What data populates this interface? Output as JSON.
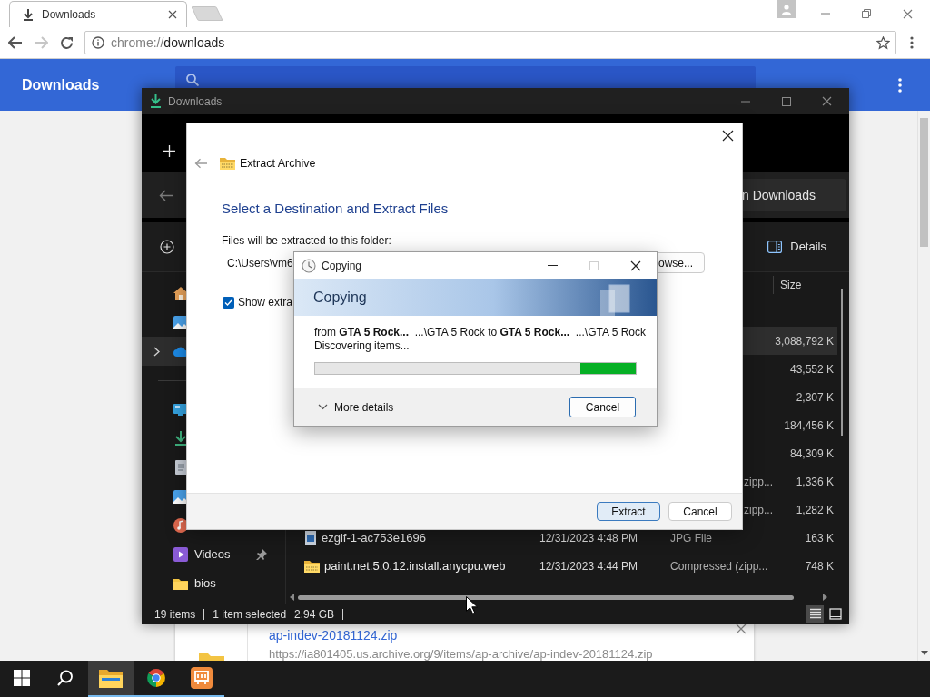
{
  "browser": {
    "tab_title": "Downloads",
    "address_scheme": "chrome://",
    "address_path": "downloads",
    "page_title": "Downloads",
    "download": {
      "filename": "ap-indev-20181124.zip",
      "url": "https://ia801405.us.archive.org/9/items/ap-archive/ap-indev-20181124.zip"
    }
  },
  "explorer": {
    "title": "Downloads",
    "search_text": "n Downloads",
    "details_label": "Details",
    "size_header": "Size",
    "sidebar": [
      {
        "kind": "home",
        "selected": false,
        "expandable": false,
        "pinned": false
      },
      {
        "kind": "gallery",
        "selected": false,
        "expandable": false,
        "pinned": false
      },
      {
        "kind": "onedrive",
        "selected": true,
        "expandable": true,
        "pinned": false
      },
      {
        "kind": "desktop",
        "selected": false,
        "expandable": false,
        "pinned": false
      },
      {
        "kind": "downloads",
        "selected": false,
        "expandable": false,
        "pinned": false
      },
      {
        "kind": "documents",
        "selected": false,
        "expandable": false,
        "pinned": false
      },
      {
        "kind": "pictures",
        "selected": false,
        "expandable": false,
        "pinned": false
      },
      {
        "kind": "music",
        "selected": false,
        "expandable": false,
        "pinned": false
      },
      {
        "kind": "videos",
        "label": "Videos",
        "selected": false,
        "expandable": false,
        "pinned": true
      },
      {
        "kind": "folder",
        "label": "bios",
        "selected": false,
        "expandable": false,
        "pinned": false
      }
    ],
    "rows": [
      {
        "kind": "covered",
        "size": "3,088,792 K",
        "selected": true
      },
      {
        "kind": "covered",
        "size": "43,552 K",
        "selected": false
      },
      {
        "kind": "covered",
        "size": "2,307 K",
        "selected": false
      },
      {
        "kind": "covered",
        "size": "184,456 K",
        "selected": false
      },
      {
        "kind": "covered",
        "size": "84,309 K",
        "selected": false
      },
      {
        "kind": "covered",
        "type": "zipp...",
        "size": "1,336 K",
        "selected": false
      },
      {
        "kind": "covered",
        "type": "zipp...",
        "size": "1,282 K",
        "selected": false
      },
      {
        "kind": "image",
        "name": "ezgif-1-ac753e1696",
        "date": "12/31/2023 4:48 PM",
        "type": "JPG File",
        "size": "163 K",
        "selected": false
      },
      {
        "kind": "zip",
        "name": "paint.net.5.0.12.install.anycpu.web",
        "date": "12/31/2023 4:44 PM",
        "type": "Compressed (zipp...",
        "size": "748 K",
        "selected": false
      }
    ],
    "status": {
      "items": "19 items",
      "selection": "1 item selected",
      "size": "2.94 GB"
    },
    "views": [
      {
        "kind": "details",
        "selected": true
      },
      {
        "kind": "tiles",
        "selected": false
      }
    ]
  },
  "extract_dialog": {
    "title": "Extract Archive",
    "heading": "Select a Destination and Extract Files",
    "destination_label": "Files will be extracted to this folder:",
    "path": "C:\\Users\\vm6",
    "browse": "owse...",
    "show_files": {
      "label": "Show extra",
      "checked": true
    },
    "buttons": [
      {
        "label": "Extract",
        "default": true
      },
      {
        "label": "Cancel",
        "default": false
      }
    ]
  },
  "copy_dialog": {
    "title": "Copying",
    "maximize_disabled": true,
    "heading": "Copying",
    "from_line": "from **GTA 5 Rock...**  ...\\GTA 5 Rock to **GTA 5 Rock...**  ...\\GTA 5 Rock",
    "status": "Discovering items...",
    "more_details": "More details",
    "cancel": "Cancel"
  },
  "taskbar": [
    {
      "kind": "start",
      "selected": false,
      "running": false
    },
    {
      "kind": "search",
      "selected": false,
      "running": false
    },
    {
      "kind": "explorer",
      "selected": true,
      "running": true
    },
    {
      "kind": "chrome",
      "selected": false,
      "running": true
    },
    {
      "kind": "app",
      "selected": false,
      "running": true
    }
  ]
}
